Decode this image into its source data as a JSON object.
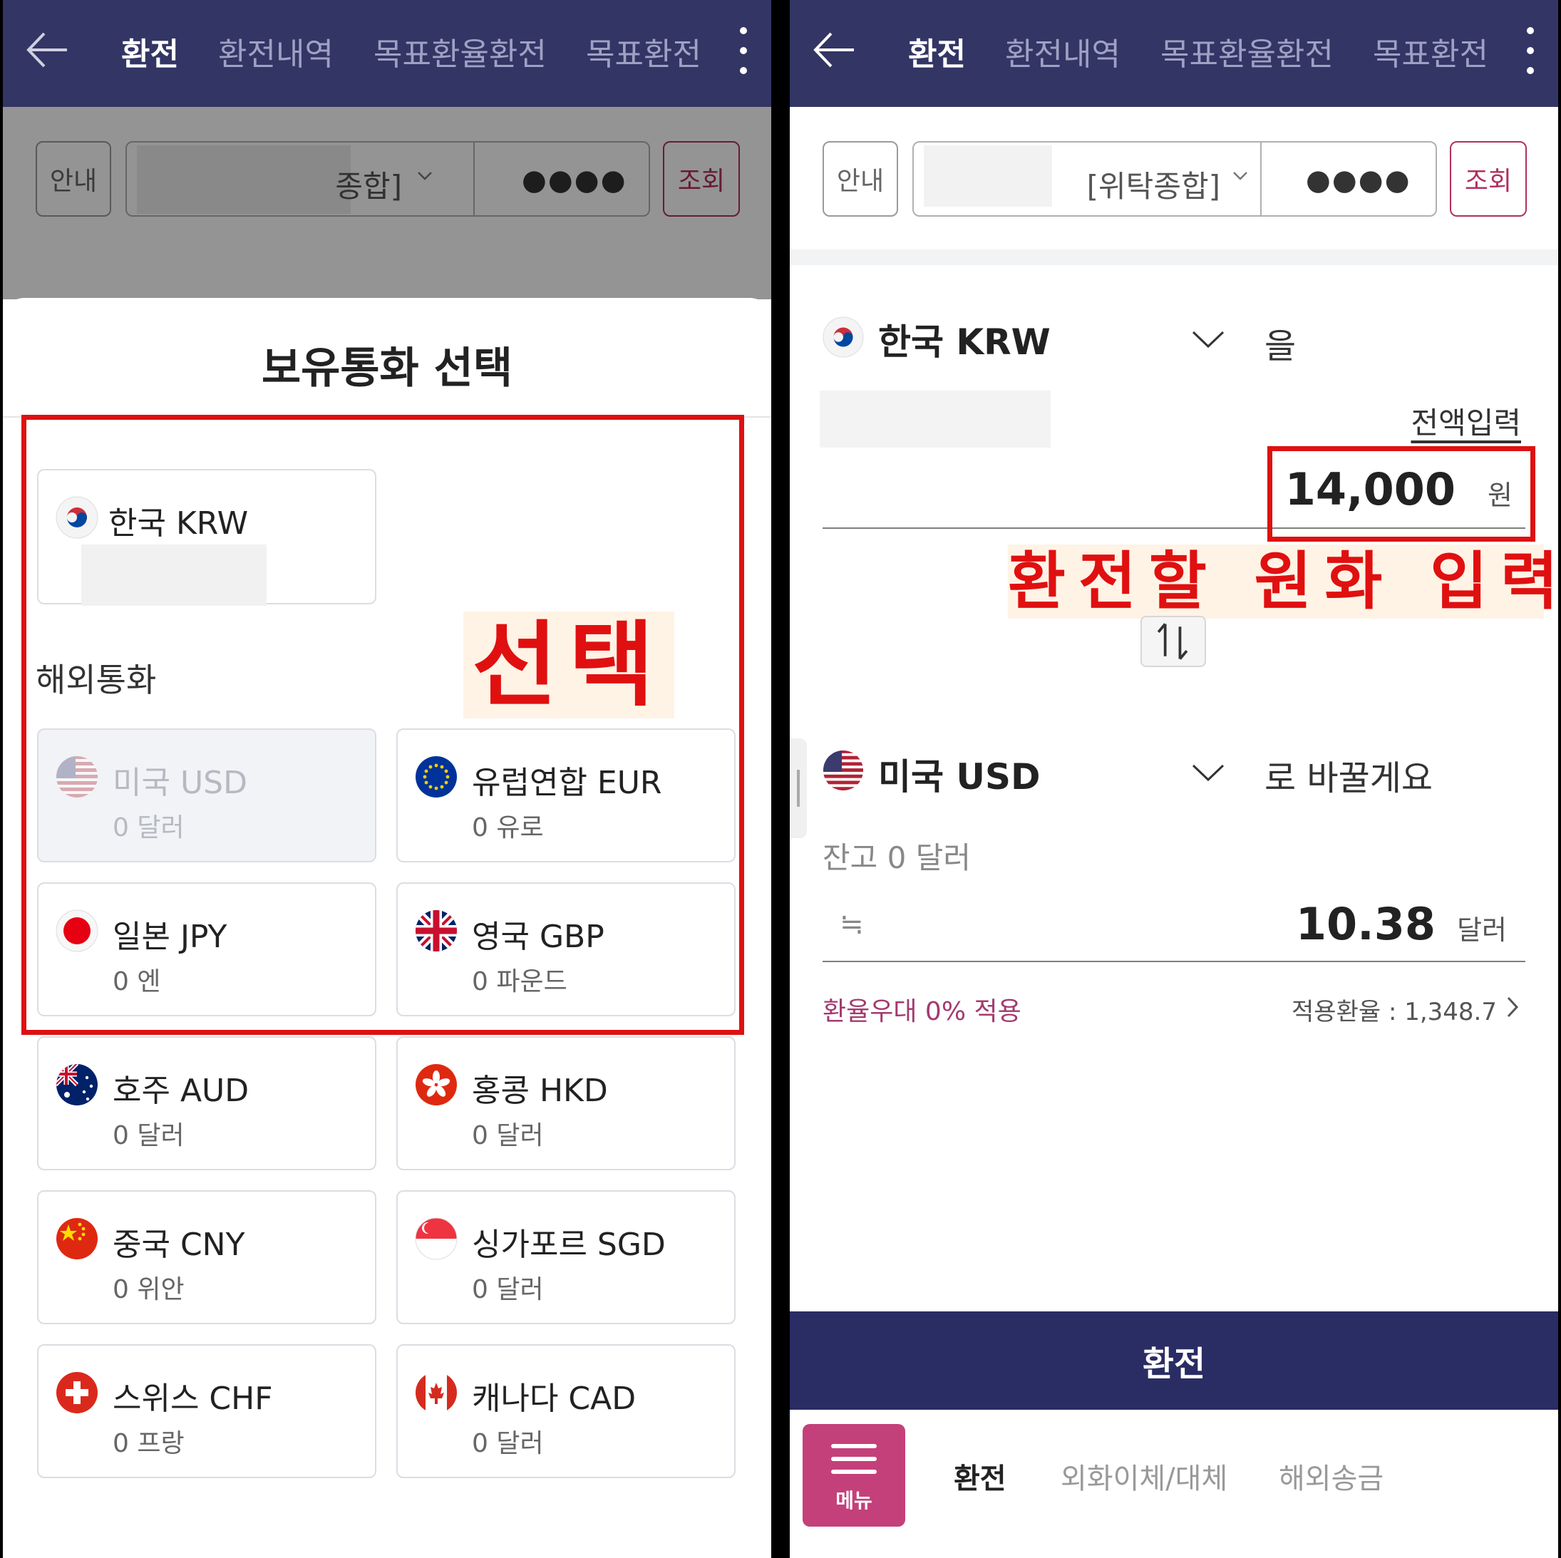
{
  "nav": {
    "tabs": [
      "환전",
      "환전내역",
      "목표환율환전",
      "목표환전"
    ]
  },
  "account": {
    "guide_label": "안내",
    "left_account_suffix": "종합]",
    "right_account_suffix": "[위탁종합]",
    "password_mask": "●●●●",
    "query_label": "조회"
  },
  "left": {
    "sheet_title": "보유통화 선택",
    "held_currency": {
      "name": "한국 KRW"
    },
    "foreign_label": "해외통화",
    "annotation": "선택",
    "currencies": [
      {
        "name": "미국 USD",
        "balance": "0 달러",
        "disabled": true
      },
      {
        "name": "유럽연합 EUR",
        "balance": "0 유로"
      },
      {
        "name": "일본 JPY",
        "balance": "0 엔"
      },
      {
        "name": "영국 GBP",
        "balance": "0 파운드"
      },
      {
        "name": "호주 AUD",
        "balance": "0 달러"
      },
      {
        "name": "홍콩 HKD",
        "balance": "0 달러"
      },
      {
        "name": "중국 CNY",
        "balance": "0 위안"
      },
      {
        "name": "싱가포르 SGD",
        "balance": "0 달러"
      },
      {
        "name": "스위스 CHF",
        "balance": "0 프랑"
      },
      {
        "name": "캐나다 CAD",
        "balance": "0 달러"
      }
    ]
  },
  "right": {
    "from_currency": "한국 KRW",
    "from_suffix": "을",
    "full_amount_link": "전액입력",
    "from_amount": "14,000",
    "from_unit": "원",
    "annotation": "환전할 원화 입력",
    "to_currency": "미국 USD",
    "to_suffix": "로 바꿀게요",
    "to_balance": "잔고 0 달러",
    "approx_symbol": "≒",
    "to_amount": "10.38",
    "to_unit": "달러",
    "promo": "환율우대 0% 적용",
    "rate_label": "적용환율 : 1,348.7",
    "submit_label": "환전"
  },
  "bottom_nav": {
    "menu_label": "메뉴",
    "items": [
      "환전",
      "외화이체/대체",
      "해외송금"
    ]
  },
  "colors": {
    "header_bg": "#333565",
    "accent": "#c4407a",
    "submit_bg": "#2a2c64",
    "annotation_red": "#dd1111"
  }
}
